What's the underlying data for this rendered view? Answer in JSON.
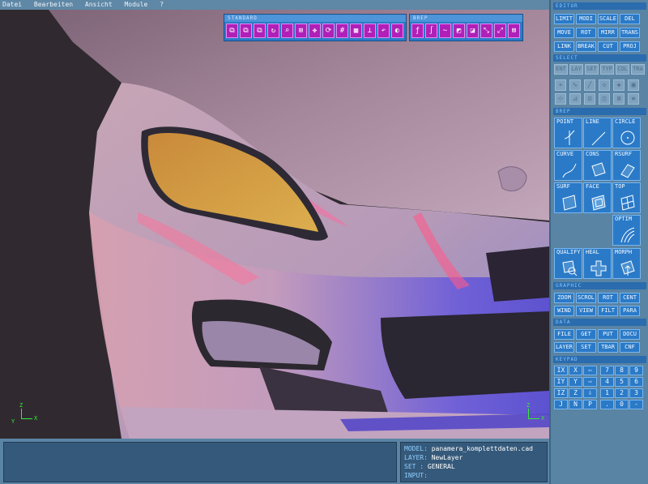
{
  "menu": [
    "Datei",
    "Bearbeiten",
    "Ansicht",
    "Module",
    "?"
  ],
  "toolbars": {
    "standard": {
      "title": "STANDARD"
    },
    "brep": {
      "title": "BREP"
    }
  },
  "status": {
    "model_key": "MODEL:",
    "model_value": "panamera_komplettdaten.cad",
    "layer_key": "LAYER:",
    "layer_value": "NewLayer",
    "set_key": "SET  :",
    "set_value": "GENERAL",
    "input_key": "INPUT:"
  },
  "panel": {
    "editor": {
      "title": "EDITOR",
      "buttons": [
        "LIMIT",
        "MODI",
        "SCALE",
        "DEL",
        "MOVE",
        "ROT",
        "MIRR",
        "TRANS",
        "LINK",
        "BREAK",
        "CUT",
        "PROJ"
      ]
    },
    "select": {
      "title": "SELECT",
      "buttons": [
        "ENT",
        "LAY",
        "SET",
        "TYP",
        "COL",
        "TRA"
      ]
    },
    "brep": {
      "title": "BREP",
      "buttons": [
        "POINT",
        "LINE",
        "CIRCLE",
        "CURVE",
        "CONS",
        "RSURF",
        "SURF",
        "FACE",
        "TOP",
        "OPTIM",
        "QUALIFY",
        "HEAL",
        "MORPH"
      ]
    },
    "graphic": {
      "title": "GRAPHIC",
      "buttons": [
        "ZOOM",
        "SCROL",
        "ROT",
        "CENT",
        "WIND",
        "VIEW",
        "FILT",
        "PARA"
      ]
    },
    "data": {
      "title": "DATA",
      "buttons": [
        "FILE",
        "GET",
        "PUT",
        "DOCU",
        "LAYER",
        "SET",
        "TBAR",
        "CNF"
      ]
    },
    "keypad": {
      "title": "KEYPAD",
      "keys": [
        "IX",
        "X",
        "⇦",
        "7",
        "8",
        "9",
        "IY",
        "Y",
        "⇨",
        "4",
        "5",
        "6",
        "IZ",
        "Z",
        "⇩",
        "1",
        "2",
        "3",
        "J",
        "N",
        "P",
        ".",
        "0",
        "-"
      ]
    }
  },
  "axes": {
    "x": "X",
    "y": "Y",
    "z": "Z"
  }
}
